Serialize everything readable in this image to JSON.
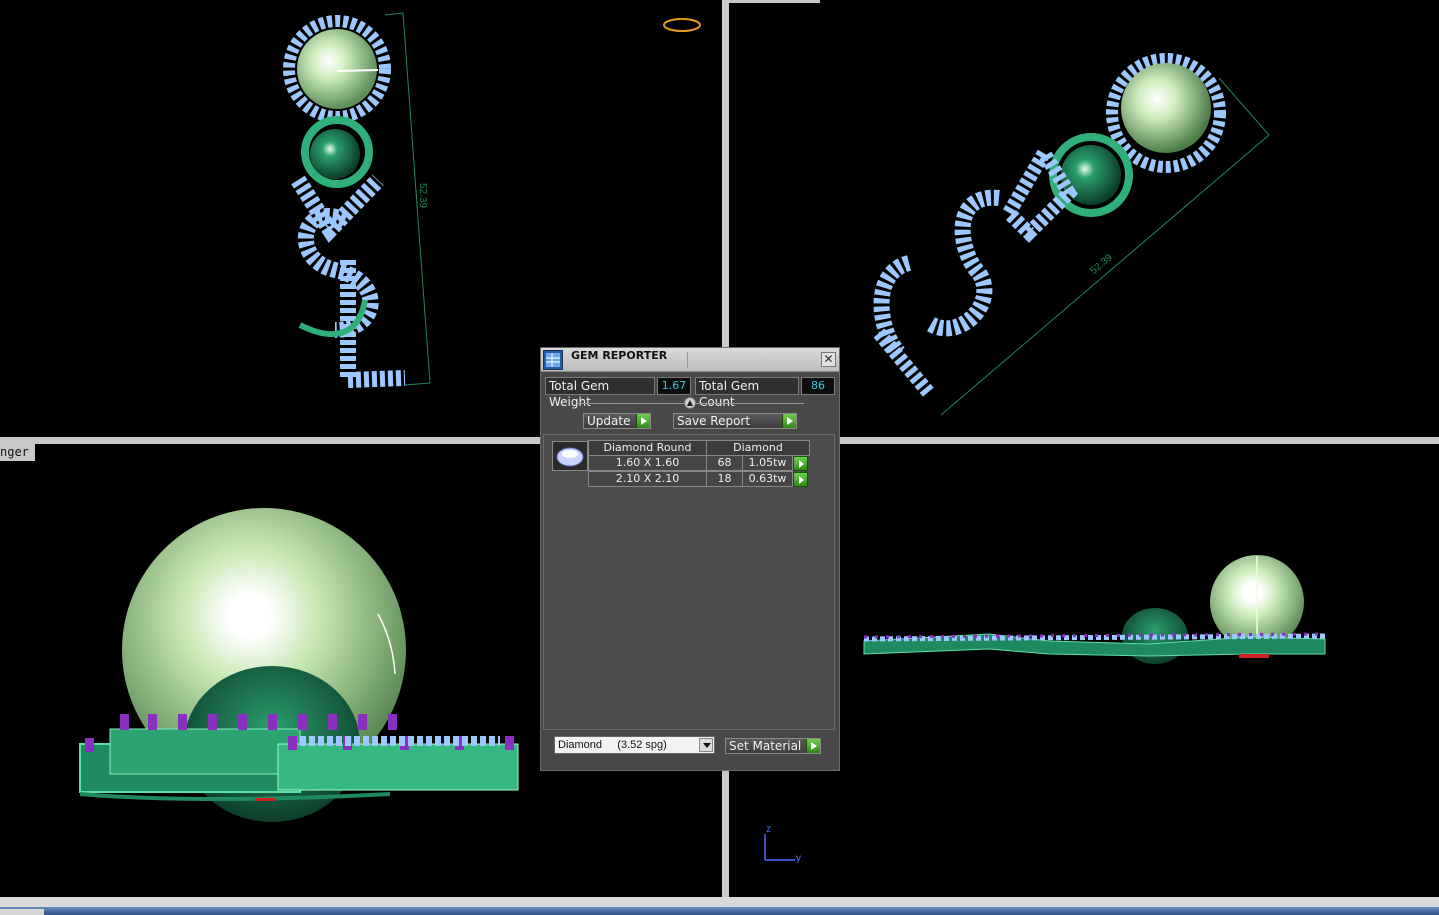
{
  "viewports": {
    "top_left": {
      "dimension": "52.39"
    },
    "top_right": {
      "dimension": "52.39"
    },
    "bottom_left": {
      "tab_label": "nger"
    },
    "bottom_right": {
      "axis_z": "z",
      "axis_y": "y"
    }
  },
  "gem_reporter": {
    "title": "GEM REPORTER",
    "close": "✕",
    "total_gem_weight_label": "Total Gem Weight",
    "total_gem_weight": "1.67",
    "total_gem_count_label": "Total Gem Count",
    "total_gem_count": "86",
    "update_label": "Update",
    "save_report_label": "Save Report",
    "table": {
      "header_cut": "Diamond Round",
      "header_material": "Diamond",
      "rows": [
        {
          "size": "1.60 X 1.60",
          "count": "68",
          "weight": "1.05tw"
        },
        {
          "size": "2.10 X 2.10",
          "count": "18",
          "weight": "0.63tw"
        }
      ]
    },
    "material_select": "Diamond     (3.52 spg)",
    "set_material_label": "Set Material"
  },
  "colors": {
    "background": "#000000",
    "gem_blue": "#9cc8ff",
    "metal_green": "#2fb07a",
    "pearl_light": "#cfeec0",
    "prong_purple": "#8a2fc0",
    "dimension_green": "#1f8a55",
    "value_cyan": "#3fc7d8"
  }
}
